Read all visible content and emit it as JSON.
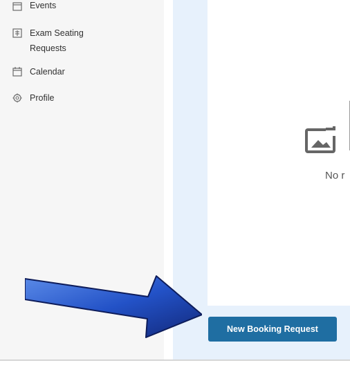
{
  "sidebar": {
    "items": [
      {
        "label": "Events",
        "icon": "calendar-icon"
      },
      {
        "label": "Exam Seating",
        "label2": "Requests",
        "icon": "seating-request-icon"
      },
      {
        "label": "Calendar",
        "icon": "calendar-icon"
      },
      {
        "label": "Profile",
        "icon": "gear-icon"
      }
    ]
  },
  "main": {
    "empty_state": {
      "text": "No r",
      "icon": "image-placeholder-icon"
    },
    "new_booking_button": "New Booking Request"
  },
  "annotation": {
    "icon": "arrow-icon",
    "color": "#1f4ec0"
  },
  "colors": {
    "accent": "#1f6ea2",
    "panel": "#e7f1fc",
    "sidebar": "#f6f6f6"
  }
}
